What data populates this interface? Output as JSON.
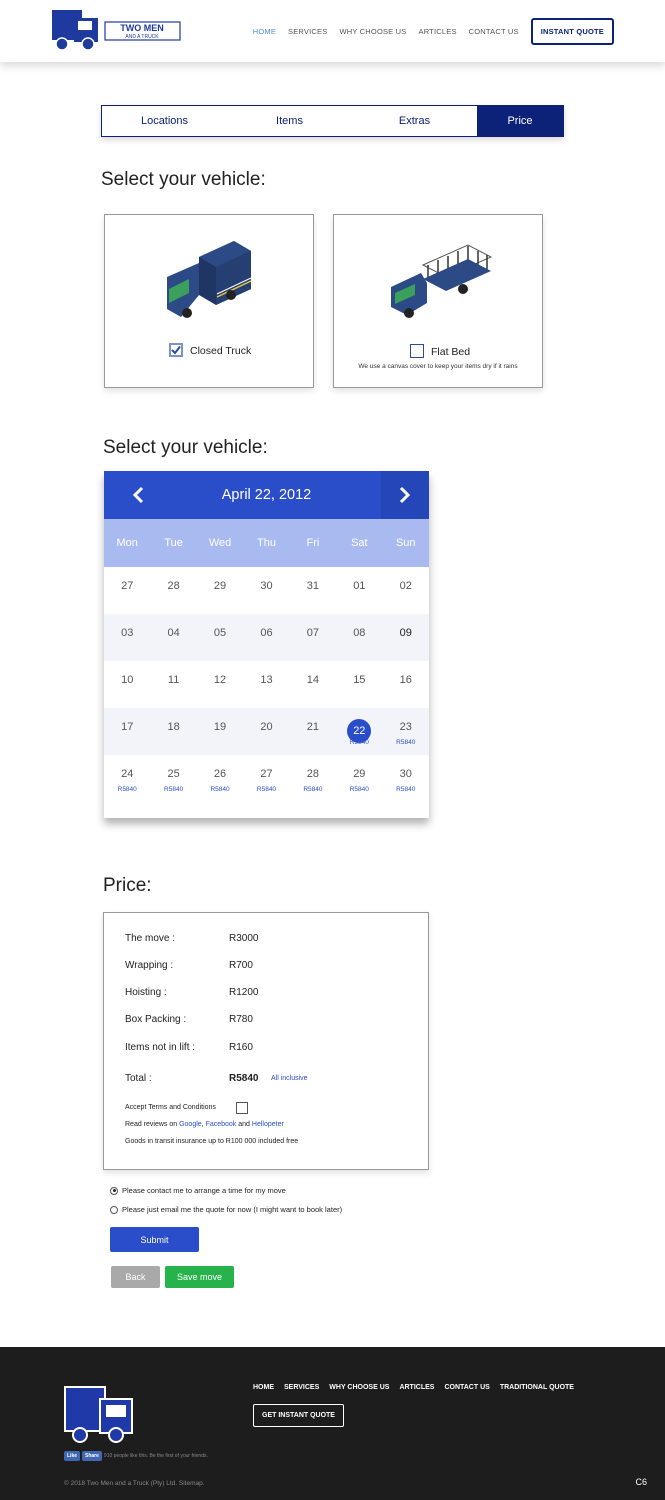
{
  "header": {
    "brand_line1": "TWO MEN",
    "brand_line2": "AND A TRUCK",
    "nav": [
      "HOME",
      "SERVICES",
      "WHY CHOOSE US",
      "ARTICLES",
      "CONTACT US"
    ],
    "quote_button": "INSTANT QUOTE"
  },
  "tabs": [
    "Locations",
    "Items",
    "Extras",
    "Price"
  ],
  "active_tab": "Price",
  "vehicle_heading": "Select your vehicle:",
  "vehicles": [
    {
      "label": "Closed Truck",
      "checked": true,
      "note": ""
    },
    {
      "label": "Flat Bed",
      "checked": false,
      "note": "We use a canvas cover to keep your items dry if it rains"
    }
  ],
  "date_heading": "Select your vehicle:",
  "calendar": {
    "title": "April 22, 2012",
    "prev_icon": "chevron-left",
    "next_icon": "chevron-right",
    "days": [
      "Mon",
      "Tue",
      "Wed",
      "Thu",
      "Fri",
      "Sat",
      "Sun"
    ],
    "weeks": [
      [
        {
          "d": "27"
        },
        {
          "d": "28"
        },
        {
          "d": "29"
        },
        {
          "d": "30"
        },
        {
          "d": "31"
        },
        {
          "d": "01"
        },
        {
          "d": "02"
        }
      ],
      [
        {
          "d": "03"
        },
        {
          "d": "04"
        },
        {
          "d": "05"
        },
        {
          "d": "06"
        },
        {
          "d": "07"
        },
        {
          "d": "08"
        },
        {
          "d": "09",
          "bold": true
        }
      ],
      [
        {
          "d": "10"
        },
        {
          "d": "11"
        },
        {
          "d": "12"
        },
        {
          "d": "13"
        },
        {
          "d": "14"
        },
        {
          "d": "15"
        },
        {
          "d": "16"
        }
      ],
      [
        {
          "d": "17"
        },
        {
          "d": "18"
        },
        {
          "d": "19"
        },
        {
          "d": "20"
        },
        {
          "d": "21"
        },
        {
          "d": "22",
          "sel": true,
          "p": "R5840"
        },
        {
          "d": "23",
          "p": "R5840"
        }
      ],
      [
        {
          "d": "24",
          "p": "R5840"
        },
        {
          "d": "25",
          "p": "R5840"
        },
        {
          "d": "26",
          "p": "R5840"
        },
        {
          "d": "27",
          "p": "R5840"
        },
        {
          "d": "28",
          "p": "R5840"
        },
        {
          "d": "29",
          "p": "R5840"
        },
        {
          "d": "30",
          "p": "R5840"
        }
      ]
    ]
  },
  "price_heading": "Price:",
  "price": {
    "rows": [
      {
        "label": "The move :",
        "value": "R3000"
      },
      {
        "label": "Wrapping :",
        "value": "R700"
      },
      {
        "label": "Hoisting :",
        "value": "R1200"
      },
      {
        "label": "Box Packing :",
        "value": "R780"
      },
      {
        "label": "Items not in lift :",
        "value": "R160"
      }
    ],
    "total_label": "Total :",
    "total_value": "R5840",
    "total_note": "All inclusive",
    "terms_label": "Accept Terms and Conditions",
    "reviews_prefix": "Read reviews on",
    "review_google": "Google",
    "review_facebook": "Facebook",
    "review_and": "and",
    "review_hellopeter": "Hellopeter",
    "insurance": "Goods in transit insurance up to R100 000 included free"
  },
  "contact_options": [
    {
      "label": "Please contact me to arrange a time for my move",
      "selected": true
    },
    {
      "label": "Please just email me the quote for now (I might want to book later)",
      "selected": false
    }
  ],
  "buttons": {
    "submit": "Submit",
    "back": "Back",
    "save": "Save move"
  },
  "colors": {
    "navy": "#0b2278",
    "blue": "#2a4dc9",
    "green": "#28b24b",
    "grey": "#a9a9a9"
  },
  "footer": {
    "nav": [
      "HOME",
      "SERVICES",
      "WHY CHOOSE US",
      "ARTICLES",
      "CONTACT US",
      "TRADITIONAL QUOTE"
    ],
    "quote_button": "GET INSTANT QUOTE",
    "fb_like": "Like",
    "fb_share": "Share",
    "fb_text": "910 people like this. Be the first of your friends.",
    "copyright": "© 2018 Two Men and a Truck (Pty) Ltd. Sitemap.",
    "badge": "C6"
  }
}
